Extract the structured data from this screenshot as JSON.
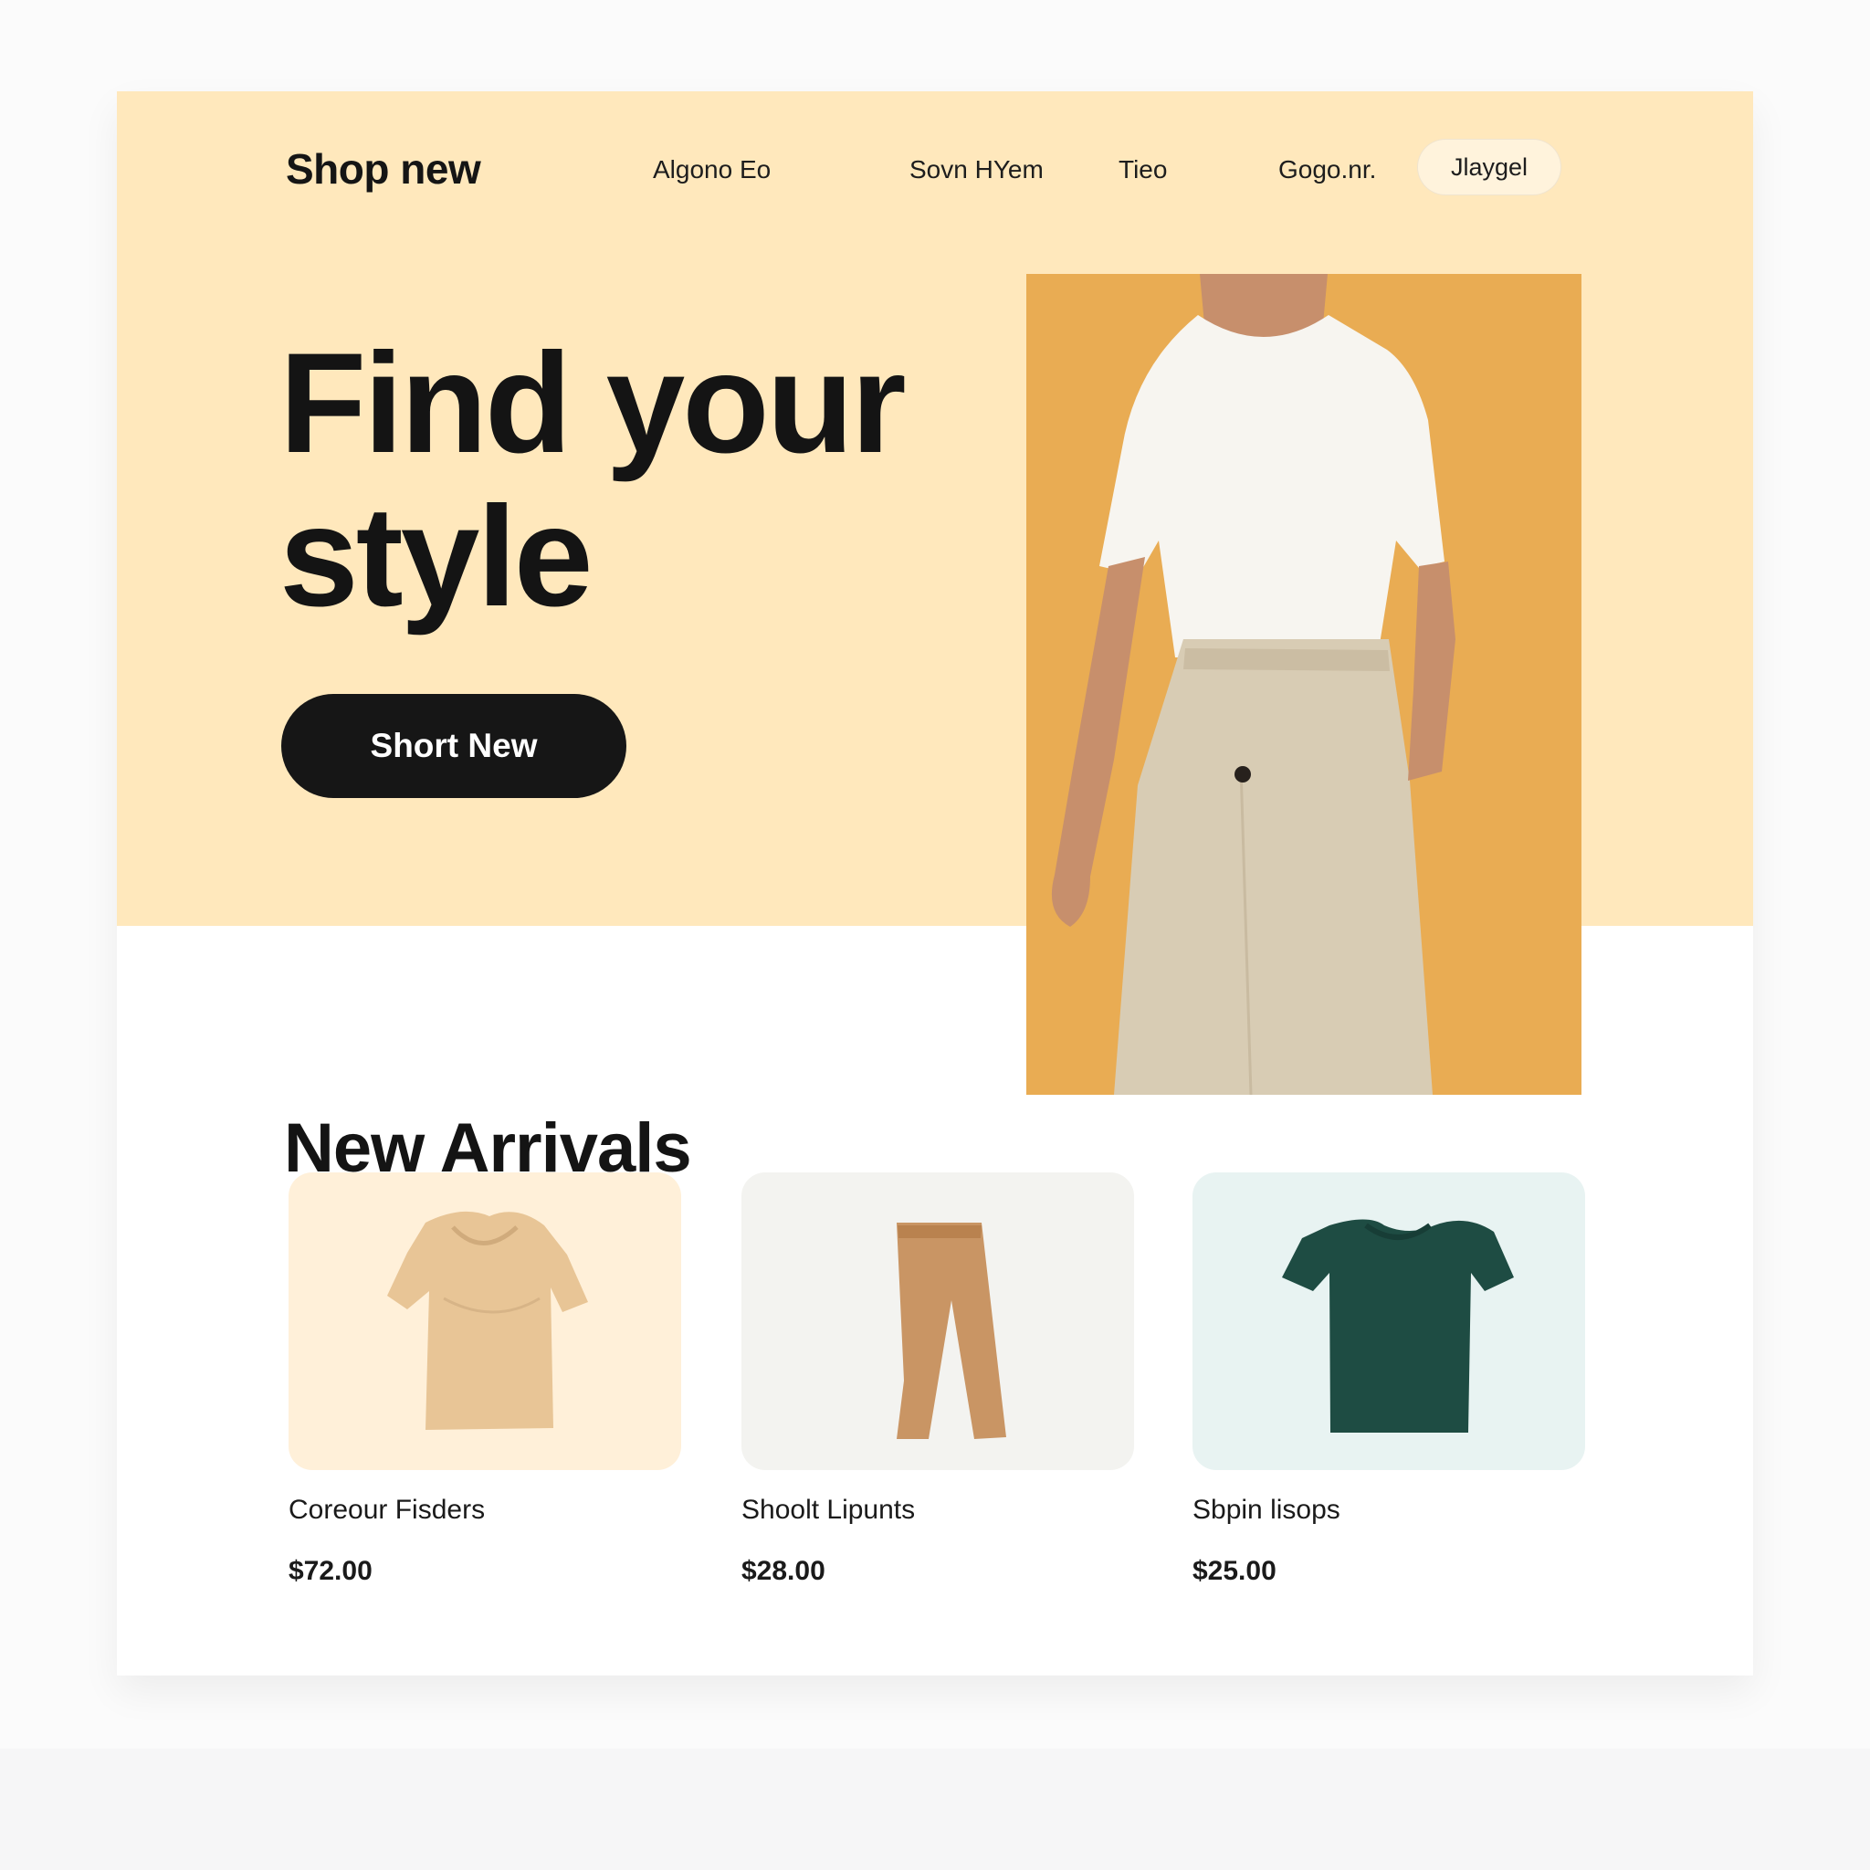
{
  "header": {
    "brand": "Shop new",
    "nav_links": [
      "Algono Eo",
      "Sovn HYem",
      "Tieo",
      "Gogo.nr."
    ],
    "nav_button": "Jlaygel"
  },
  "hero": {
    "title": "Find your style",
    "cta_label": "Short New",
    "image": "model-photo-white-tshirt-beige-pants"
  },
  "new_arrivals": {
    "title": "New Arrivals",
    "products": [
      {
        "name": "Coreour Fisders",
        "price": "$72.00",
        "image": "beige-shirt",
        "bg": "#fff0d9",
        "item_color": "#e8c596"
      },
      {
        "name": "Shoolt Lipunts",
        "price": "$28.00",
        "image": "tan-pants",
        "bg": "#f3f3f0",
        "item_color": "#c99564"
      },
      {
        "name": "Sbpin lisops",
        "price": "$25.00",
        "image": "dark-green-tshirt",
        "bg": "#e8f3f2",
        "item_color": "#1e4c43"
      }
    ]
  },
  "colors": {
    "hero_background": "#ffe8bc",
    "hero_photo_background": "#e9ac53",
    "text_primary": "#141414",
    "cta_background": "#161616",
    "cta_text": "#ffffff"
  }
}
